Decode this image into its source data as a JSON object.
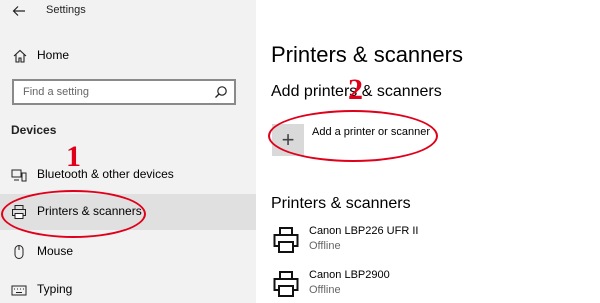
{
  "window": {
    "title": "Settings"
  },
  "sidebar": {
    "home_label": "Home",
    "search": {
      "placeholder": "Find a setting"
    },
    "section_heading": "Devices",
    "items": [
      {
        "label": "Bluetooth & other devices",
        "icon": "bluetooth-icon"
      },
      {
        "label": "Printers & scanners",
        "icon": "printer-icon",
        "selected": true
      },
      {
        "label": "Mouse",
        "icon": "mouse-icon"
      },
      {
        "label": "Typing",
        "icon": "keyboard-icon"
      }
    ]
  },
  "main": {
    "title": "Printers & scanners",
    "add_section": {
      "heading": "Add printers & scanners",
      "add_button_label": "Add a printer or scanner"
    },
    "list_section": {
      "heading": "Printers & scanners",
      "printers": [
        {
          "name": "Canon LBP226 UFR II",
          "status": "Offline"
        },
        {
          "name": "Canon LBP2900",
          "status": "Offline"
        }
      ]
    }
  },
  "annotations": [
    {
      "label": "1",
      "target": "Printers & scanners",
      "color": "#e0001a"
    },
    {
      "label": "2",
      "target": "Add a printer or scanner",
      "color": "#e0001a"
    }
  ],
  "colors": {
    "sidebar_bg": "#f2f2f2",
    "selected_bg": "#e0e0e0",
    "annotation": "#e0001a"
  }
}
